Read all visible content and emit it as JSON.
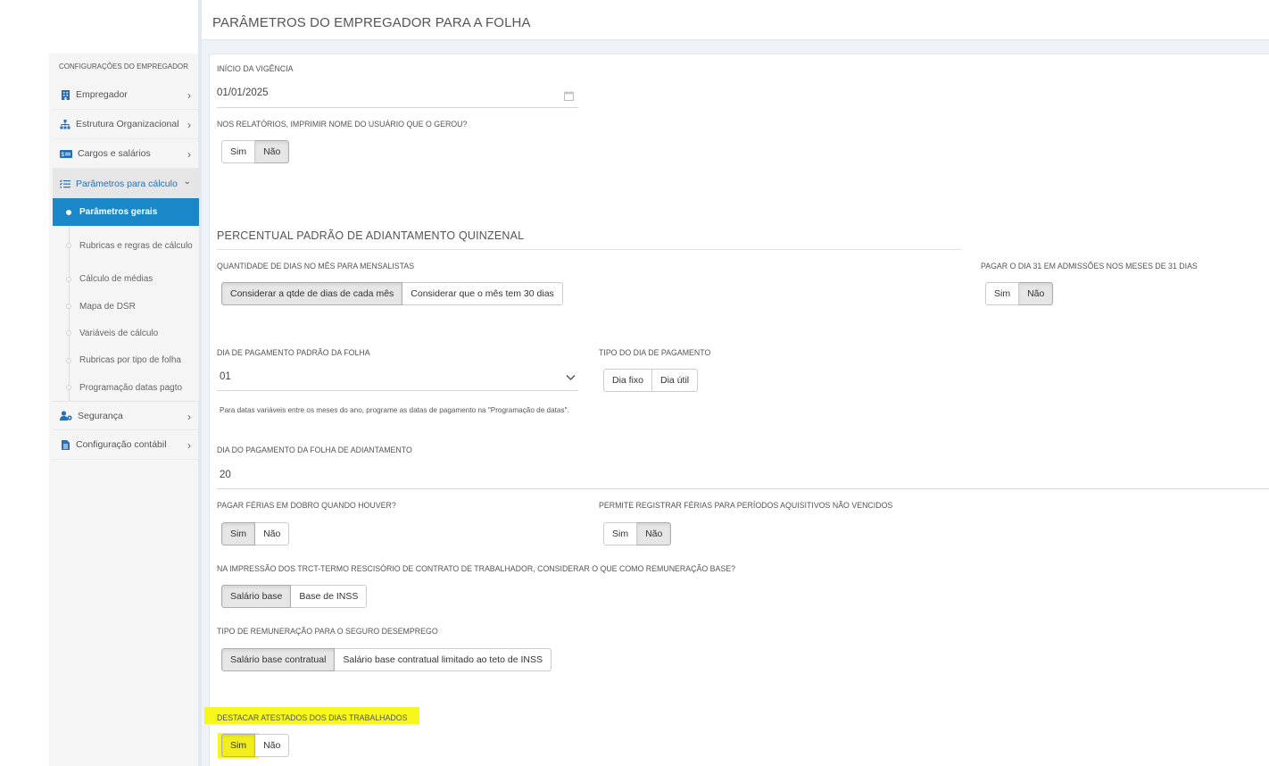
{
  "page": {
    "title": "PARÂMETROS DO EMPREGADOR PARA A FOLHA"
  },
  "sidebar": {
    "header": "CONFIGURAÇÕES DO EMPREGADOR",
    "items": [
      {
        "label": "Empregador",
        "icon": "building-icon"
      },
      {
        "label": "Estrutura Organizacional",
        "icon": "org-chart-icon"
      },
      {
        "label": "Cargos e salários",
        "icon": "salary-card-icon"
      },
      {
        "label": "Parâmetros para cálculo",
        "icon": "checklist-icon"
      },
      {
        "label": "Segurança",
        "icon": "user-lock-icon"
      },
      {
        "label": "Configuração contábil",
        "icon": "document-icon"
      }
    ],
    "subitems": [
      "Parâmetros gerais",
      "Rubricas e regras de cálculo",
      "Cálculo de médias",
      "Mapa de DSR",
      "Variáveis de cálculo",
      "Rubricas por tipo de folha",
      "Programação datas pagto"
    ]
  },
  "form": {
    "inicio_vigencia": {
      "label": "INÍCIO DA VIGÊNCIA",
      "value": "01/01/2025"
    },
    "imprimir_usuario": {
      "label": "NOS RELATÓRIOS, IMPRIMIR NOME DO USUÁRIO QUE O GEROU?",
      "options": [
        "Sim",
        "Não"
      ],
      "selected": "Não"
    },
    "section_adiantamento": "PERCENTUAL PADRÃO DE ADIANTAMENTO QUINZENAL",
    "qtde_dias": {
      "label": "QUANTIDADE DE DIAS NO MÊS PARA MENSALISTAS",
      "options": [
        "Considerar a qtde de dias de cada mês",
        "Considerar que o mês tem 30 dias"
      ],
      "selected": "Considerar a qtde de dias de cada mês"
    },
    "pagar_dia31": {
      "label": "PAGAR O DIA 31 EM ADMISSÕES NOS MESES DE 31 DIAS",
      "options": [
        "Sim",
        "Não"
      ],
      "selected": "Não"
    },
    "dia_pagamento": {
      "label": "DIA DE PAGAMENTO PADRÃO DA FOLHA",
      "value": "01"
    },
    "tipo_dia": {
      "label": "TIPO DO DIA DE PAGAMENTO",
      "options": [
        "Dia fixo",
        "Dia útil"
      ],
      "selected": ""
    },
    "nota_datas": "Para datas variáveis entre os meses do ano, programe as datas de pagamento na \"Programação de datas\".",
    "dia_adiantamento": {
      "label": "DIA DO PAGAMENTO DA FOLHA DE ADIANTAMENTO",
      "value": "20"
    },
    "ferias_dobro": {
      "label": "PAGAR FÉRIAS EM DOBRO QUANDO HOUVER?",
      "options": [
        "Sim",
        "Não"
      ],
      "selected": "Sim"
    },
    "ferias_nao_vencidos": {
      "label": "PERMITE REGISTRAR FÉRIAS PARA PERÍODOS AQUISITIVOS NÃO VENCIDOS",
      "options": [
        "Sim",
        "Não"
      ],
      "selected": "Não"
    },
    "trct": {
      "label": "NA IMPRESSÃO DOS TRCT-TERMO RESCISÓRIO DE CONTRATO DE TRABALHADOR, CONSIDERAR O QUE COMO REMUNERAÇÃO BASE?",
      "options": [
        "Salário base",
        "Base de INSS"
      ],
      "selected": "Salário base"
    },
    "seguro_desemprego": {
      "label": "TIPO DE REMUNERAÇÃO PARA O SEGURO DESEMPREGO",
      "options": [
        "Salário base contratual",
        "Salário base contratual limitado ao teto de INSS"
      ],
      "selected": "Salário base contratual"
    },
    "atestados": {
      "label": "DESTACAR ATESTADOS DOS DIAS TRABALHADOS",
      "options": [
        "Sim",
        "Não"
      ],
      "selected": "Sim"
    }
  },
  "colors": {
    "accent": "#1a88c8",
    "highlight": "#f7f71c",
    "link": "#2a6fb5"
  }
}
